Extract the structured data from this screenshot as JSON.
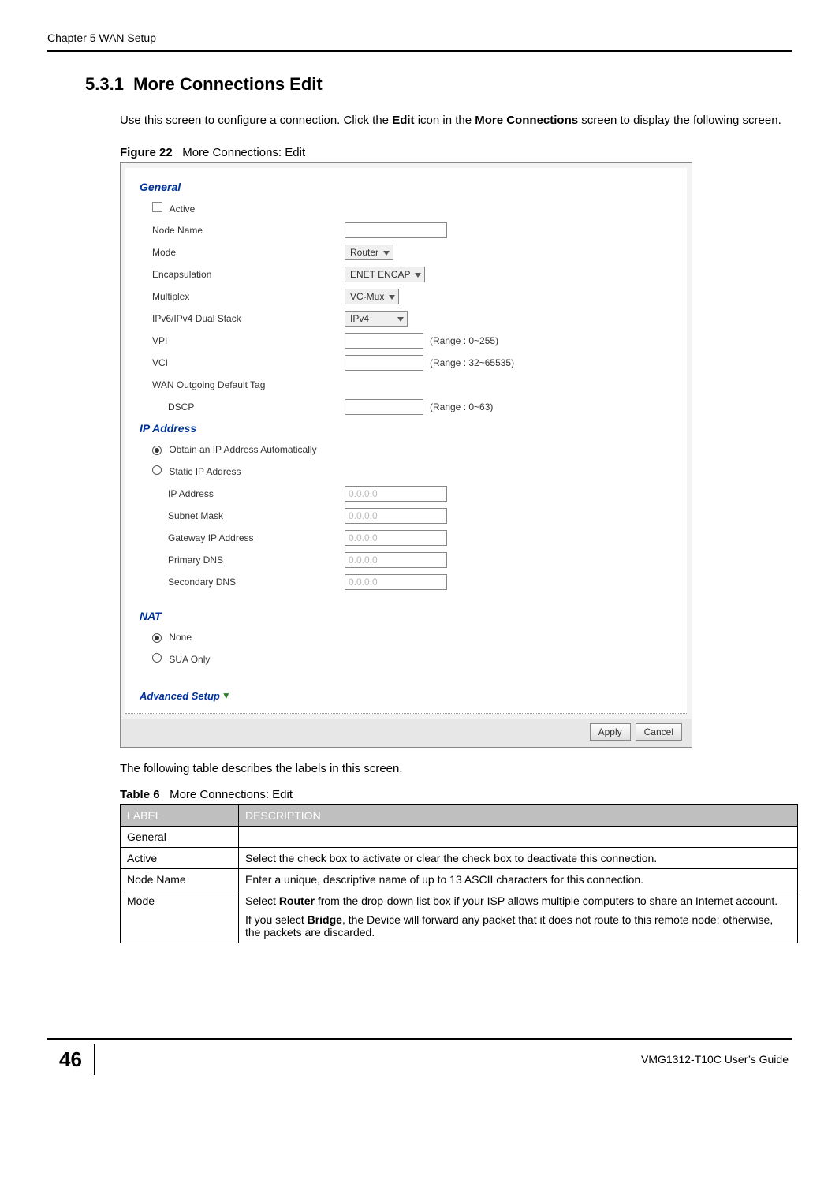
{
  "header": {
    "chapter": "Chapter 5 WAN Setup"
  },
  "section": {
    "number": "5.3.1",
    "title": "More Connections Edit",
    "intro_parts": [
      "Use this screen to configure a connection. Click the ",
      "Edit",
      " icon in the ",
      "More Connections",
      " screen to display the following screen."
    ]
  },
  "figure": {
    "label": "Figure 22",
    "caption": "More Connections: Edit",
    "general": {
      "heading": "General",
      "active_label": "Active",
      "node_name_label": "Node Name",
      "mode_label": "Mode",
      "mode_value": "Router",
      "encap_label": "Encapsulation",
      "encap_value": "ENET ENCAP",
      "multiplex_label": "Multiplex",
      "multiplex_value": "VC-Mux",
      "ipver_label": "IPv6/IPv4 Dual Stack",
      "ipver_value": "IPv4",
      "vpi_label": "VPI",
      "vpi_range": "(Range : 0~255)",
      "vci_label": "VCI",
      "vci_range": "(Range : 32~65535)",
      "wan_tag_label": "WAN Outgoing Default Tag",
      "dscp_label": "DSCP",
      "dscp_range": "(Range : 0~63)"
    },
    "ip": {
      "heading": "IP Address",
      "auto_label": "Obtain an IP Address Automatically",
      "static_label": "Static IP Address",
      "ip_label": "IP Address",
      "subnet_label": "Subnet Mask",
      "gateway_label": "Gateway IP Address",
      "pdns_label": "Primary DNS",
      "sdns_label": "Secondary DNS",
      "placeholder": "0.0.0.0"
    },
    "nat": {
      "heading": "NAT",
      "none_label": "None",
      "sua_label": "SUA Only"
    },
    "adv": {
      "label": "Advanced Setup"
    },
    "buttons": {
      "apply": "Apply",
      "cancel": "Cancel"
    }
  },
  "below_figure": "The following table describes the labels in this screen.",
  "table": {
    "label": "Table 6",
    "caption": "More Connections: Edit",
    "head": {
      "label": "LABEL",
      "desc": "DESCRIPTION"
    },
    "rows": [
      {
        "label": "General",
        "desc_parts": [
          ""
        ]
      },
      {
        "label": "Active",
        "desc_parts": [
          "Select the check box to activate or clear the check box to deactivate this connection."
        ]
      },
      {
        "label": "Node Name",
        "desc_parts": [
          "Enter a unique, descriptive name of up to 13 ASCII characters for this connection."
        ]
      },
      {
        "label": "Mode",
        "desc_mode": {
          "p1a": "Select ",
          "p1b": "Router",
          "p1c": " from the drop-down list box if your ISP allows multiple computers to share an Internet account.",
          "p2a": "If you select ",
          "p2b": "Bridge",
          "p2c": ", the Device will forward any packet that it does not route to this remote node; otherwise, the packets are discarded."
        }
      }
    ]
  },
  "footer": {
    "page": "46",
    "guide": "VMG1312-T10C User’s Guide"
  }
}
